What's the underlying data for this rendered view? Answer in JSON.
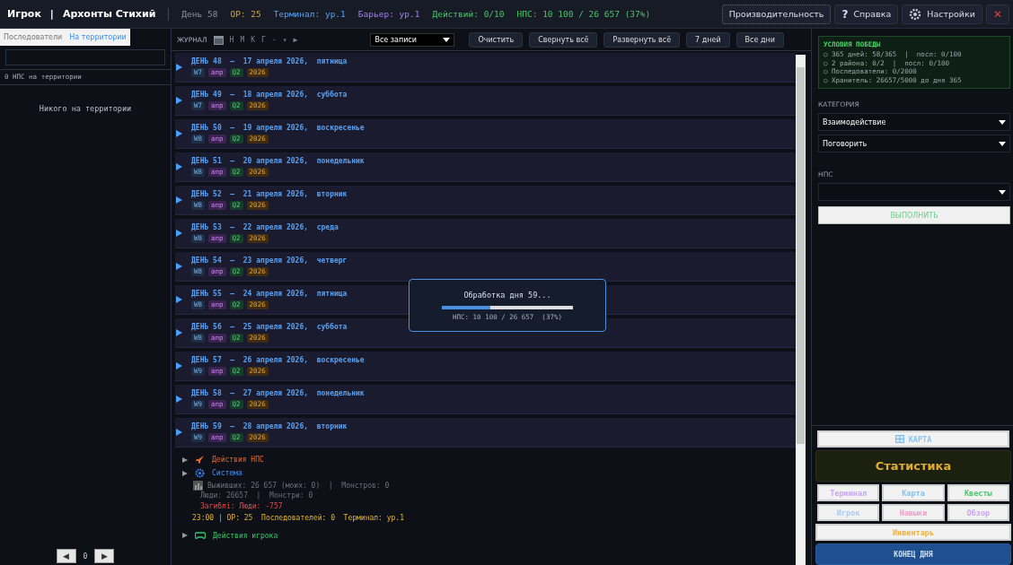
{
  "header": {
    "player": "Игрок",
    "separator": "|",
    "game": "Архонты Стихий",
    "stats": [
      {
        "kind": "day",
        "text": "День 58"
      },
      {
        "kind": "op",
        "text": "ОР: 25"
      },
      {
        "kind": "terminal",
        "text": "Терминал: ур.1"
      },
      {
        "kind": "barrier",
        "text": "Барьер: ур.1"
      },
      {
        "kind": "actions",
        "text": "Действий: 0/10"
      },
      {
        "kind": "npc",
        "text": "НПС: 10 100 / 26 657  (37%)"
      }
    ],
    "buttons": [
      {
        "kind": "plain",
        "label": "Производительность"
      },
      {
        "kind": "help",
        "label": "Справка",
        "icon": "?"
      },
      {
        "kind": "settings",
        "label": "Настройки"
      },
      {
        "kind": "close",
        "label": "✕"
      }
    ]
  },
  "left": {
    "tabs": [
      {
        "label": "Последователи",
        "selected": false
      },
      {
        "label": "На территории",
        "selected": true
      }
    ],
    "count": "0 НПС на территории",
    "empty": "Никого на территории",
    "pager": {
      "prev": "◀",
      "page": "0",
      "next": "▶"
    }
  },
  "journal": {
    "title": "ЖУРНАЛ",
    "nav": [
      "Н",
      "М",
      "К",
      "Г",
      "-",
      "▾",
      "▶"
    ],
    "filter": "Все записи",
    "buttons": [
      "Очистить",
      "Свернуть всё",
      "Развернуть всё",
      "7 дней",
      "Все дни"
    ],
    "days": [
      {
        "title": "ДЕНЬ 48  —  17 апреля 2026,  пятница",
        "tags": [
          "W7",
          "апр",
          "Q2",
          "2026"
        ]
      },
      {
        "title": "ДЕНЬ 49  —  18 апреля 2026,  суббота",
        "tags": [
          "W7",
          "апр",
          "Q2",
          "2026"
        ]
      },
      {
        "title": "ДЕНЬ 50  —  19 апреля 2026,  воскресенье",
        "tags": [
          "W8",
          "апр",
          "Q2",
          "2026"
        ]
      },
      {
        "title": "ДЕНЬ 51  —  20 апреля 2026,  понедельник",
        "tags": [
          "W8",
          "апр",
          "Q2",
          "2026"
        ]
      },
      {
        "title": "ДЕНЬ 52  —  21 апреля 2026,  вторник",
        "tags": [
          "W8",
          "апр",
          "Q2",
          "2026"
        ]
      },
      {
        "title": "ДЕНЬ 53  —  22 апреля 2026,  среда",
        "tags": [
          "W8",
          "апр",
          "Q2",
          "2026"
        ]
      },
      {
        "title": "ДЕНЬ 54  —  23 апреля 2026,  четверг",
        "tags": [
          "W8",
          "апр",
          "Q2",
          "2026"
        ]
      },
      {
        "title": "ДЕНЬ 55  —  24 апреля 2026,  пятница",
        "tags": [
          "W8",
          "апр",
          "Q2",
          "2026"
        ]
      },
      {
        "title": "ДЕНЬ 56  —  25 апреля 2026,  суббота",
        "tags": [
          "W8",
          "апр",
          "Q2",
          "2026"
        ]
      },
      {
        "title": "ДЕНЬ 57  —  26 апреля 2026,  воскресенье",
        "tags": [
          "W9",
          "апр",
          "Q2",
          "2026"
        ]
      },
      {
        "title": "ДЕНЬ 58  —  27 апреля 2026,  понедельник",
        "tags": [
          "W9",
          "апр",
          "Q2",
          "2026"
        ]
      },
      {
        "title": "ДЕНЬ 59  —  28 апреля 2026,  вторник",
        "tags": [
          "W9",
          "апр",
          "Q2",
          "2026"
        ]
      }
    ],
    "details": [
      {
        "kind": "npc",
        "label": "Действия НПС",
        "expanded": false
      },
      {
        "kind": "system",
        "label": "Система",
        "expanded": false
      }
    ],
    "stats": {
      "survivors": "Выживших: 26 657 (моих: 0)  |  Монстров: 0",
      "people": "Люди: 26657  |  Монстри: 0",
      "dead": "Загиблі: Люди: -757",
      "summary": "23:00 | ОР: 25  Последователей: 0  Терминал: ур.1"
    },
    "player_actions": {
      "label": "Действия игрока",
      "expanded": false
    }
  },
  "progress": {
    "title": "Обработка дня 59...",
    "level": 0.37,
    "reading": "НПС: 10 100 / 26 657  (37%)"
  },
  "right": {
    "victory": {
      "title": "УСЛОВИЯ ПОБЕДЫ",
      "items": [
        "○ 365 дней: 58/365  |  посл: 0/100",
        "○ 2 района: 0/2  |  посл: 0/100",
        "○ Последователи: 0/2000",
        "○ Хранитель: 26657/5000 до дня 365"
      ]
    },
    "category_label": "КАТЕГОРИЯ",
    "category": "Взаимодействие",
    "action": "Поговорить",
    "npc_label": "НПС",
    "execute": "ВЫПОЛНИТЬ",
    "map": "КАРТА",
    "stats_title": "Статистика",
    "grid": [
      {
        "label": "Терминал",
        "color": "#c9a6f5"
      },
      {
        "label": "Карта",
        "color": "#7cc4f2"
      },
      {
        "label": "Квесты",
        "color": "#4cc96a"
      },
      {
        "label": "Игрок",
        "color": "#a9cdf5"
      },
      {
        "label": "Навыки",
        "color": "#f59ac9"
      },
      {
        "label": "Обзор",
        "color": "#c9a6f5"
      }
    ],
    "inventory": "Инвентарь",
    "end_day": "КОНЕЦ ДНЯ"
  }
}
